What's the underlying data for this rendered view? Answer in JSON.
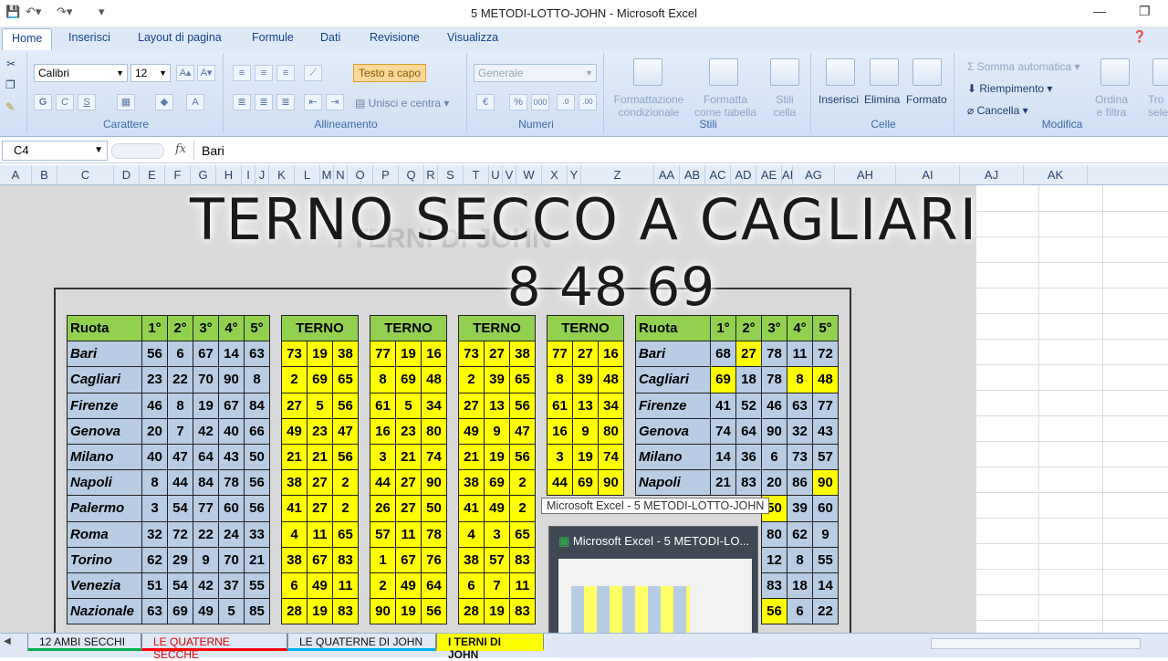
{
  "window": {
    "title": "5 METODI-LOTTO-JOHN - Microsoft Excel"
  },
  "ribbon_tabs": [
    "Home",
    "Inserisci",
    "Layout di pagina",
    "Formule",
    "Dati",
    "Revisione",
    "Visualizza"
  ],
  "ribbon": {
    "font_name": "Calibri",
    "font_size": "12",
    "font_group": "Carattere",
    "wrap_text": "Testo a capo",
    "merge_center": "Unisci e centra",
    "align_group": "Allineamento",
    "number_format": "Generale",
    "number_group": "Numeri",
    "cond_format_1": "Formattazione",
    "cond_format_2": "condizionale",
    "format_table_1": "Formatta",
    "format_table_2": "come tabella",
    "cell_styles_1": "Stili",
    "cell_styles_2": "cella",
    "styles_group": "Stili",
    "insert": "Inserisci",
    "delete": "Elimina",
    "format": "Formato",
    "cells_group": "Celle",
    "autosum": "Somma automatica",
    "fill": "Riempimento",
    "clear": "Cancella",
    "sort_1": "Ordina",
    "sort_2": "e filtra",
    "find_1": "Tro",
    "find_2": "selezi",
    "edit_group": "Modifica"
  },
  "formula_bar": {
    "name_box": "C4",
    "fx": "fx",
    "content": "Bari"
  },
  "columns": [
    "A",
    "B",
    "C",
    "D",
    "E",
    "F",
    "G",
    "H",
    "I",
    "J",
    "K",
    "L",
    "M",
    "N",
    "O",
    "P",
    "Q",
    "R",
    "S",
    "T",
    "U",
    "V",
    "W",
    "X",
    "Y",
    "Z",
    "AA",
    "AB",
    "AC",
    "AD",
    "AE",
    "AI",
    "AG",
    "AH",
    "AI",
    "AJ",
    "AK"
  ],
  "overlay": {
    "line1": "TERNO SECCO A CAGLIARI",
    "line2": "8 48 69",
    "ghost": "I TERNI DI JOHN"
  },
  "table_left": {
    "headers": [
      "Ruota",
      "1°",
      "2°",
      "3°",
      "4°",
      "5°"
    ],
    "rows": [
      [
        "Bari",
        "56",
        "6",
        "67",
        "14",
        "63"
      ],
      [
        "Cagliari",
        "23",
        "22",
        "70",
        "90",
        "8"
      ],
      [
        "Firenze",
        "46",
        "8",
        "19",
        "67",
        "84"
      ],
      [
        "Genova",
        "20",
        "7",
        "42",
        "40",
        "66"
      ],
      [
        "Milano",
        "40",
        "47",
        "64",
        "43",
        "50"
      ],
      [
        "Napoli",
        "8",
        "44",
        "84",
        "78",
        "56"
      ],
      [
        "Palermo",
        "3",
        "54",
        "77",
        "60",
        "56"
      ],
      [
        "Roma",
        "32",
        "72",
        "22",
        "24",
        "33"
      ],
      [
        "Torino",
        "62",
        "29",
        "9",
        "70",
        "21"
      ],
      [
        "Venezia",
        "51",
        "54",
        "42",
        "37",
        "55"
      ],
      [
        "Nazionale",
        "63",
        "69",
        "49",
        "5",
        "85"
      ]
    ]
  },
  "terno_blocks": [
    {
      "header": "TERNO",
      "rows": [
        [
          "73",
          "19",
          "38"
        ],
        [
          "2",
          "69",
          "65"
        ],
        [
          "27",
          "5",
          "56"
        ],
        [
          "49",
          "23",
          "47"
        ],
        [
          "21",
          "21",
          "56"
        ],
        [
          "38",
          "27",
          "2"
        ],
        [
          "41",
          "27",
          "2"
        ],
        [
          "4",
          "11",
          "65"
        ],
        [
          "38",
          "67",
          "83"
        ],
        [
          "6",
          "49",
          "11"
        ],
        [
          "28",
          "19",
          "83"
        ]
      ]
    },
    {
      "header": "TERNO",
      "rows": [
        [
          "77",
          "19",
          "16"
        ],
        [
          "8",
          "69",
          "48"
        ],
        [
          "61",
          "5",
          "34"
        ],
        [
          "16",
          "23",
          "80"
        ],
        [
          "3",
          "21",
          "74"
        ],
        [
          "44",
          "27",
          "90"
        ],
        [
          "26",
          "27",
          "50"
        ],
        [
          "57",
          "11",
          "78"
        ],
        [
          "1",
          "67",
          "76"
        ],
        [
          "2",
          "49",
          "64"
        ],
        [
          "90",
          "19",
          "56"
        ]
      ]
    },
    {
      "header": "TERNO",
      "rows": [
        [
          "73",
          "27",
          "38"
        ],
        [
          "2",
          "39",
          "65"
        ],
        [
          "27",
          "13",
          "56"
        ],
        [
          "49",
          "9",
          "47"
        ],
        [
          "21",
          "19",
          "56"
        ],
        [
          "38",
          "69",
          "2"
        ],
        [
          "41",
          "49",
          "2"
        ],
        [
          "4",
          "3",
          "65"
        ],
        [
          "38",
          "57",
          "83"
        ],
        [
          "6",
          "7",
          "11"
        ],
        [
          "28",
          "19",
          "83"
        ]
      ]
    },
    {
      "header": "TERNO",
      "rows": [
        [
          "77",
          "27",
          "16"
        ],
        [
          "8",
          "39",
          "48"
        ],
        [
          "61",
          "13",
          "34"
        ],
        [
          "16",
          "9",
          "80"
        ],
        [
          "3",
          "19",
          "74"
        ],
        [
          "44",
          "69",
          "90"
        ],
        [
          "",
          "",
          ""
        ],
        [
          "",
          "",
          ""
        ],
        [
          "",
          "",
          ""
        ],
        [
          "",
          "",
          ""
        ],
        [
          "",
          "",
          ""
        ]
      ]
    }
  ],
  "table_right": {
    "headers": [
      "Ruota",
      "1°",
      "2°",
      "3°",
      "4°",
      "5°"
    ],
    "rows": [
      [
        "Bari",
        "68",
        "27",
        "78",
        "11",
        "72"
      ],
      [
        "Cagliari",
        "69",
        "18",
        "78",
        "8",
        "48"
      ],
      [
        "Firenze",
        "41",
        "52",
        "46",
        "63",
        "77"
      ],
      [
        "Genova",
        "74",
        "64",
        "90",
        "32",
        "43"
      ],
      [
        "Milano",
        "14",
        "36",
        "6",
        "73",
        "57"
      ],
      [
        "Napoli",
        "21",
        "83",
        "20",
        "86",
        "90"
      ],
      [
        "",
        "",
        "",
        "50",
        "39",
        "60"
      ],
      [
        "",
        "",
        "",
        "80",
        "62",
        "9"
      ],
      [
        "",
        "",
        "",
        "12",
        "8",
        "55"
      ],
      [
        "",
        "",
        "",
        "83",
        "18",
        "14"
      ],
      [
        "",
        "",
        "",
        "56",
        "6",
        "22"
      ]
    ],
    "highlighted": [
      [
        0,
        2
      ],
      [
        1,
        1
      ],
      [
        1,
        4
      ],
      [
        1,
        5
      ],
      [
        5,
        5
      ],
      [
        6,
        3
      ],
      [
        10,
        3
      ]
    ]
  },
  "tooltip": "Microsoft Excel - 5 METODI-LOTTO-JOHN",
  "taskbar_preview": "Microsoft Excel - 5 METODI-LO...",
  "sheet_tabs": [
    {
      "label": "12 AMBI SECCHI",
      "color": "#00b050"
    },
    {
      "label": "LE QUATERNE SECCHE",
      "color": "#ff0000"
    },
    {
      "label": "LE QUATERNE DI JOHN",
      "color": "#00b0f0"
    },
    {
      "label": "I TERNI DI JOHN",
      "color": "#ffff00"
    }
  ]
}
